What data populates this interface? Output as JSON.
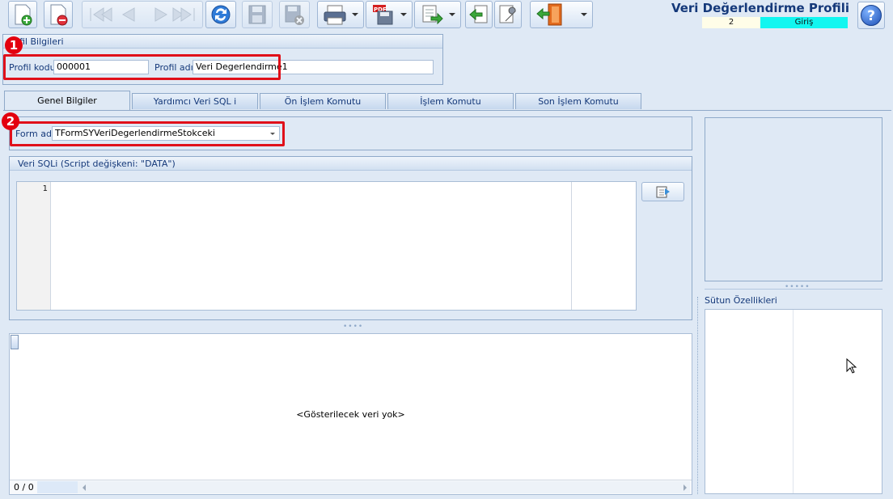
{
  "toolbar": {
    "buttons": [
      {
        "name": "new-record-button",
        "icon": "new-document-icon"
      },
      {
        "name": "delete-record-button",
        "icon": "delete-document-icon"
      },
      {
        "name": "first-record-button",
        "icon": "first-icon"
      },
      {
        "name": "previous-record-button",
        "icon": "previous-icon"
      },
      {
        "name": "next-record-button",
        "icon": "next-icon"
      },
      {
        "name": "last-record-button",
        "icon": "last-icon"
      },
      {
        "name": "refresh-button",
        "icon": "refresh-icon"
      },
      {
        "name": "save-button",
        "icon": "save-icon"
      },
      {
        "name": "cancel-button",
        "icon": "cancel-save-icon"
      },
      {
        "name": "print-button",
        "icon": "printer-icon"
      },
      {
        "name": "export-pdf-button",
        "icon": "pdf-icon"
      },
      {
        "name": "export-button",
        "icon": "export-icon"
      },
      {
        "name": "import-button",
        "icon": "import-icon"
      },
      {
        "name": "settings-button",
        "icon": "wrench-icon"
      },
      {
        "name": "exit-button",
        "icon": "exit-door-icon"
      }
    ]
  },
  "header": {
    "title": "Veri Değerlendirme Profili",
    "record_count": "2",
    "mode": "Giriş",
    "help_label": "?",
    "mode_color": "#12f6f0"
  },
  "profile_group": {
    "title": "fil Bilgileri",
    "code_label": "Profil kodu",
    "code_value": "000001",
    "name_label": "Profil adı",
    "name_value": "Veri Degerlendirme1"
  },
  "callouts": {
    "one": "1",
    "two": "2",
    "color": "#e0101a"
  },
  "tabs": [
    {
      "label": "Genel Bilgiler",
      "active": true
    },
    {
      "label": "Yardımcı Veri SQL i",
      "active": false
    },
    {
      "label": "Ön İşlem Komutu",
      "active": false
    },
    {
      "label": "İşlem Komutu",
      "active": false
    },
    {
      "label": "Son İşlem Komutu",
      "active": false
    }
  ],
  "form_group": {
    "label": "Form adı",
    "value": "TFormSYVeriDegerlendirmeStokceki"
  },
  "sql_group": {
    "title": "Veri SQLi (Script değişkeni: \"DATA\")",
    "line_number": "1"
  },
  "grid": {
    "empty_text": "<Gösterilecek veri yok>",
    "record_nav": "0 / 0"
  },
  "right_panel": {
    "columns_title": "Sütun Özellikleri"
  }
}
